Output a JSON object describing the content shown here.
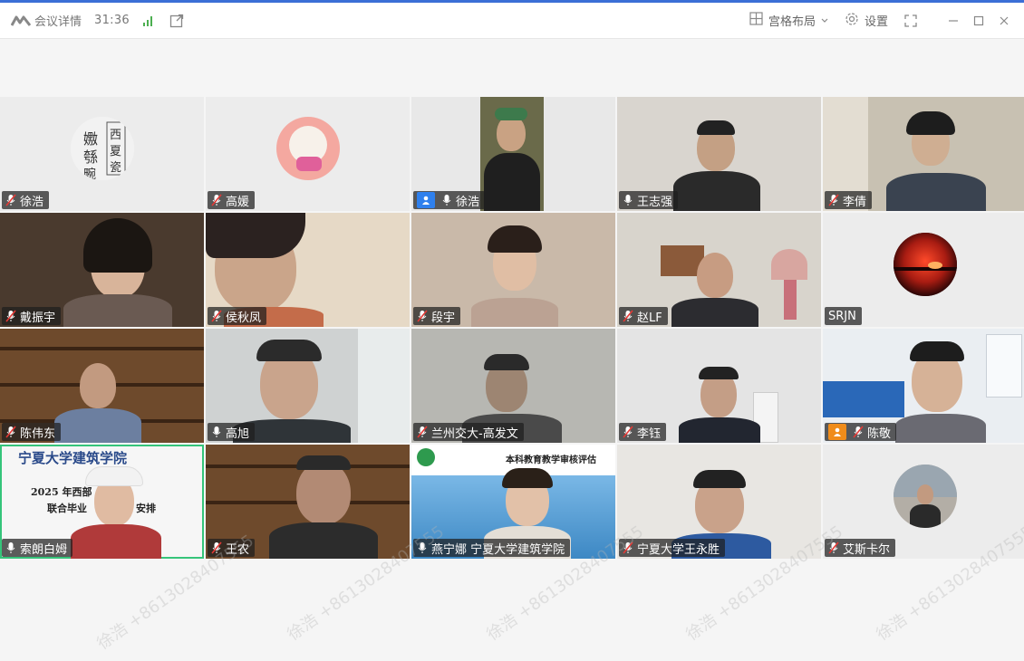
{
  "titlebar": {
    "meeting_details": "会议详情",
    "timer": "31:36",
    "layout_label": "宫格布局",
    "settings_label": "设置"
  },
  "participants": [
    {
      "name": "徐浩"
    },
    {
      "name": "高媛"
    },
    {
      "name": "徐浩"
    },
    {
      "name": "王志强"
    },
    {
      "name": "李倩"
    },
    {
      "name": "戴振宇"
    },
    {
      "name": "侯秋凤"
    },
    {
      "name": "段宇"
    },
    {
      "name": "赵LF"
    },
    {
      "name": "SRJN"
    },
    {
      "name": "陈伟东"
    },
    {
      "name": "高旭"
    },
    {
      "name": "兰州交大-高发文"
    },
    {
      "name": "李钰"
    },
    {
      "name": "陈敬"
    },
    {
      "name": "索朗白姆"
    },
    {
      "name": "王农"
    },
    {
      "name": "燕宁娜 宁夏大学建筑学院"
    },
    {
      "name": "宁夏大学王永胜"
    },
    {
      "name": "艾斯卡尔"
    }
  ],
  "slide": {
    "school": "宁夏大学建筑学院",
    "year_title": "2025 年西部",
    "subtitle": "联合毕业",
    "arrange": "安排"
  },
  "banner": {
    "title": "本科教育教学审核评估"
  },
  "watermark": "徐浩 +8613028407555",
  "colors": {
    "accent": "#3b6fd6",
    "active_border": "#35c47a",
    "host_badge": "#2f80ed"
  }
}
